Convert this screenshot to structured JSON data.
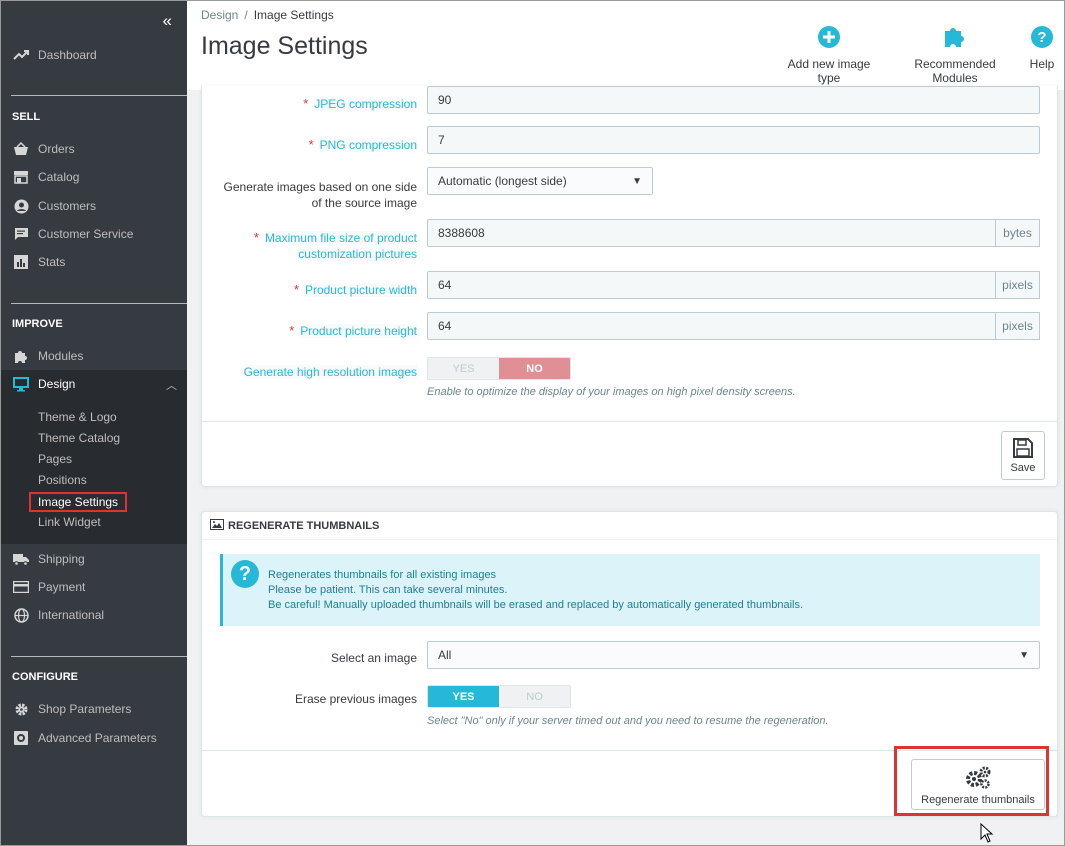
{
  "sidebar": {
    "collapse": "«",
    "dashboard": "Dashboard",
    "sections": {
      "sell": "SELL",
      "improve": "IMPROVE",
      "configure": "CONFIGURE"
    },
    "sell_items": [
      "Orders",
      "Catalog",
      "Customers",
      "Customer Service",
      "Stats"
    ],
    "improve_items": [
      "Modules",
      "Design"
    ],
    "design_sub": [
      "Theme & Logo",
      "Theme Catalog",
      "Pages",
      "Positions",
      "Image Settings",
      "Link Widget"
    ],
    "after_design": [
      "Shipping",
      "Payment",
      "International"
    ],
    "configure_items": [
      "Shop Parameters",
      "Advanced Parameters"
    ]
  },
  "header": {
    "breadcrumb": [
      "Design",
      "Image Settings"
    ],
    "title": "Image Settings",
    "toolbar": {
      "add_image_type": "Add new image type",
      "recommended_modules": "Recommended Modules",
      "help": "Help"
    }
  },
  "settings_form": {
    "jpeg_label": "JPEG compression",
    "jpeg_value": "90",
    "png_label": "PNG compression",
    "png_value": "7",
    "generate_side_label_1": "Generate images based on one side",
    "generate_side_label_2": "of the source image",
    "generate_side_value": "Automatic (longest side)",
    "max_size_label_1": "Maximum file size of product",
    "max_size_label_2": "customization pictures",
    "max_size_value": "8388608",
    "max_size_unit": "bytes",
    "width_label": "Product picture width",
    "width_value": "64",
    "width_unit": "pixels",
    "height_label": "Product picture height",
    "height_value": "64",
    "height_unit": "pixels",
    "hires_label": "Generate high resolution images",
    "hires_yes": "YES",
    "hires_no": "NO",
    "hires_selected": "NO",
    "hires_help": "Enable to optimize the display of your images on high pixel density screens.",
    "save": "Save"
  },
  "regenerate": {
    "heading": "REGENERATE THUMBNAILS",
    "alert_lines": [
      "Regenerates thumbnails for all existing images",
      "Please be patient. This can take several minutes.",
      "Be careful! Manually uploaded thumbnails will be erased and replaced by automatically generated thumbnails."
    ],
    "select_label": "Select an image",
    "select_value": "All",
    "erase_label": "Erase previous images",
    "erase_yes": "YES",
    "erase_no": "NO",
    "erase_selected": "YES",
    "erase_help": "Select \"No\" only if your server timed out and you need to resume the regeneration.",
    "button": "Regenerate thumbnails"
  },
  "colors": {
    "accent": "#25b9d7",
    "sidebar_bg": "#363a41",
    "highlight": "#e0332f",
    "toggle_no": "#e08f95"
  }
}
